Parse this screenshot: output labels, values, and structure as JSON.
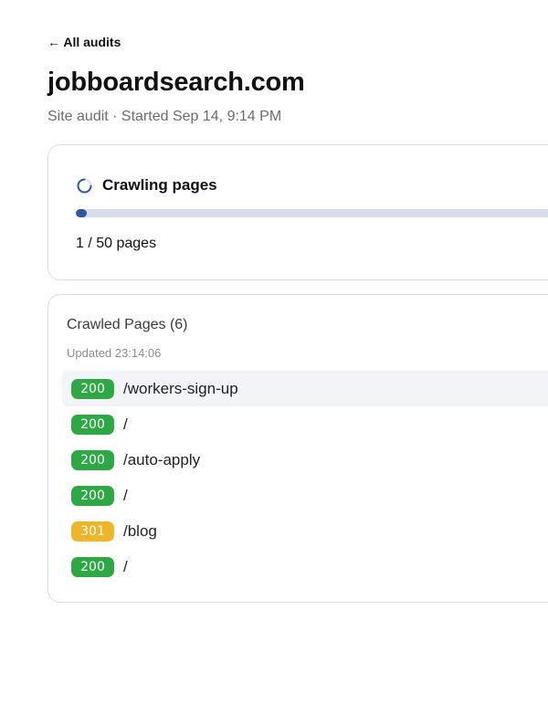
{
  "nav": {
    "back_label": "← All audits"
  },
  "header": {
    "title": "jobboardsearch.com",
    "subtitle": "Site audit · Started Sep 14, 9:14 PM"
  },
  "crawl": {
    "status": "Crawling pages",
    "progress_fraction": 0.02,
    "count_text": "1 / 50 pages",
    "spinner_icon": "spinner-icon"
  },
  "pages": {
    "heading": "Crawled Pages (6)",
    "updated": "Updated 23:14:06",
    "items": [
      {
        "status": "200",
        "path": "/workers-sign-up",
        "highlighted": true
      },
      {
        "status": "200",
        "path": "/",
        "highlighted": false
      },
      {
        "status": "200",
        "path": "/auto-apply",
        "highlighted": false
      },
      {
        "status": "200",
        "path": "/",
        "highlighted": false
      },
      {
        "status": "301",
        "path": "/blog",
        "highlighted": false
      },
      {
        "status": "200",
        "path": "/",
        "highlighted": false
      }
    ]
  },
  "colors": {
    "status_200": "#2ea845",
    "status_301": "#f0b429",
    "progress_fill": "#2f55a4",
    "progress_track": "#d7ddea"
  }
}
